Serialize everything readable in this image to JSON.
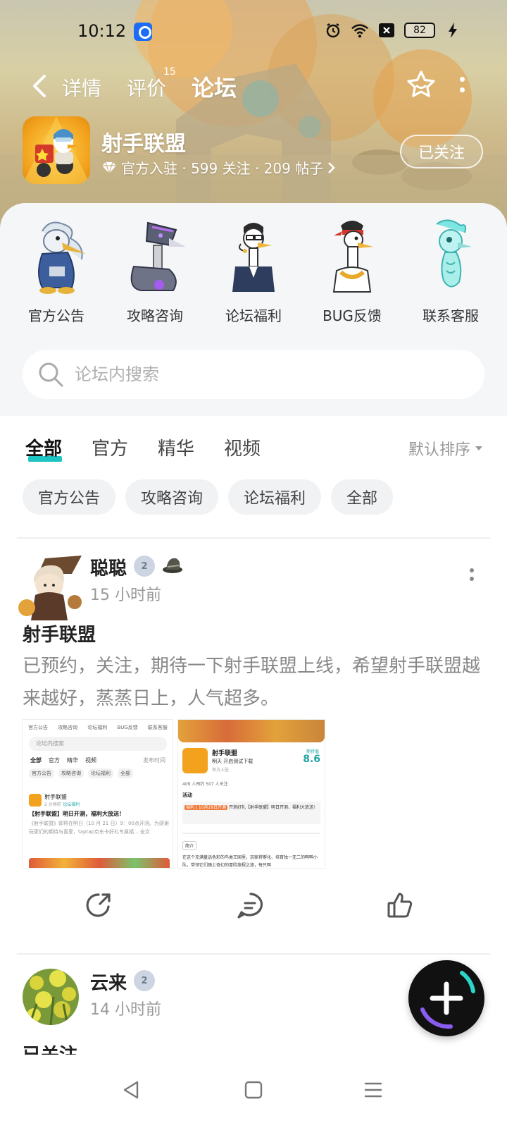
{
  "status_bar": {
    "time": "10:12",
    "battery": "82"
  },
  "nav": {
    "tabs": [
      {
        "label": "详情"
      },
      {
        "label": "评价",
        "badge": "15"
      },
      {
        "label": "论坛",
        "active": true
      }
    ]
  },
  "game": {
    "name": "射手联盟",
    "meta": "官方入驻 · 599 关注 · 209 帖子",
    "follow_label": "已关注"
  },
  "categories": [
    {
      "label": "官方公告",
      "icon": "pelican-icon"
    },
    {
      "label": "攻略咨询",
      "icon": "robot-bird-icon"
    },
    {
      "label": "论坛福利",
      "icon": "goose-glasses-icon"
    },
    {
      "label": "BUG反馈",
      "icon": "goose-headband-icon"
    },
    {
      "label": "联系客服",
      "icon": "ghost-bird-icon"
    }
  ],
  "search": {
    "placeholder": "论坛内搜索"
  },
  "filter_tabs": [
    {
      "label": "全部",
      "active": true
    },
    {
      "label": "官方"
    },
    {
      "label": "精华"
    },
    {
      "label": "视频"
    }
  ],
  "sort_label": "默认排序",
  "chips": [
    "官方公告",
    "攻略咨询",
    "论坛福利",
    "全部"
  ],
  "posts": [
    {
      "user": "聪聪",
      "level": "2",
      "time": "15 小时前",
      "title": "射手联盟",
      "body": "已预约，关注，期待一下射手联盟上线，希望射手联盟越来越好，蒸蒸日上，人气超多。",
      "thumb1": {
        "cats": [
          "官方公告",
          "攻略咨询",
          "论坛福利",
          "BUG反馈",
          "联系客服"
        ],
        "search": "论坛内搜索",
        "tabs": [
          "全部",
          "官方",
          "精华",
          "视频"
        ],
        "sort": "发布时间",
        "chips": [
          "官方公告",
          "攻略咨询",
          "论坛福利",
          "全部"
        ],
        "poster": "射手联盟",
        "poster_time": "2 分钟前",
        "poster_tag": "论坛福利",
        "headline": "【射手联盟】明日开测，福利大放送！",
        "excerpt": "《射手联盟》即将在明日（10 月 21 日）9：00点开测。为感谢玩家们的期待与喜爱，taptap京东卡好礼专属福...",
        "excerpt_more": "全文"
      },
      "thumb2": {
        "name": "射手联盟",
        "sub": "明天 开启测试下载",
        "official": "官方入驻",
        "score_label": "期待值",
        "score": "8.6",
        "stats": "409 人预约    507 人关注",
        "activity_label": "活动",
        "activity_tag": "福利 | 10月29日开测",
        "activity_text": "开测好礼【射手联盟】明日开测、福利大放送!",
        "intro_label": "简介",
        "intro": "在这个充满童话色彩的鸟类王国里，玩家将孵化、培育独一无二的鸭鸭小队，带领它们踏上奇幻的冒险旅程之旅，每只鸭"
      }
    },
    {
      "user": "云来",
      "level": "2",
      "time": "14 小时前",
      "title": "已关注"
    }
  ]
}
